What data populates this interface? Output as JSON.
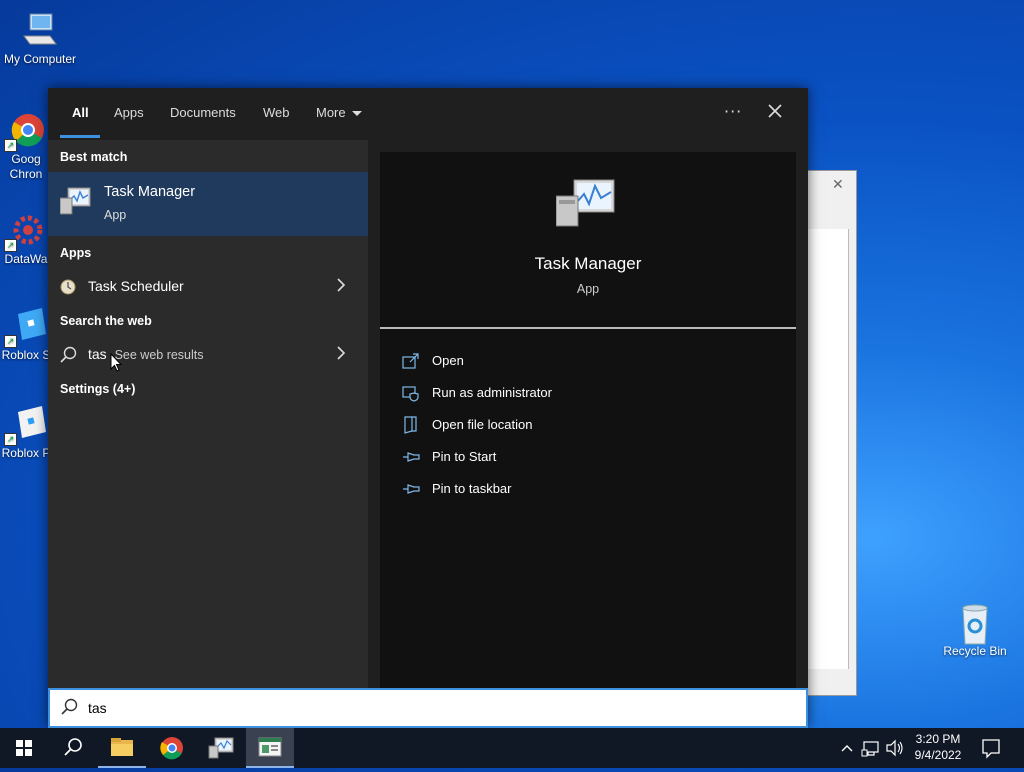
{
  "desktop": {
    "icons": [
      {
        "label": "My Computer"
      },
      {
        "label": "Goog\nChron"
      },
      {
        "label": "DataWa"
      },
      {
        "label": "Roblox S"
      },
      {
        "label": "Roblox P"
      },
      {
        "label": "Recycle Bin"
      }
    ]
  },
  "search": {
    "tabs": [
      {
        "label": "All",
        "active": true
      },
      {
        "label": "Apps"
      },
      {
        "label": "Documents"
      },
      {
        "label": "Web"
      },
      {
        "label": "More"
      }
    ],
    "more_options": "···",
    "sections": {
      "best_match": "Best match",
      "apps": "Apps",
      "web": "Search the web",
      "settings": "Settings (4+)"
    },
    "best_match": {
      "name": "Task Manager",
      "type": "App"
    },
    "apps": [
      {
        "name": "Task Scheduler"
      }
    ],
    "web": {
      "query": "tas",
      "suffix": "See web results"
    },
    "detail": {
      "name": "Task Manager",
      "type": "App",
      "actions": [
        {
          "label": "Open",
          "icon": "open-icon"
        },
        {
          "label": "Run as administrator",
          "icon": "shield-icon"
        },
        {
          "label": "Open file location",
          "icon": "file-location-icon"
        },
        {
          "label": "Pin to Start",
          "icon": "pin-icon"
        },
        {
          "label": "Pin to taskbar",
          "icon": "pin-icon"
        }
      ]
    },
    "query": "tas"
  },
  "taskbar": {
    "items": [
      "start-icon",
      "search-icon",
      "file-explorer-icon",
      "chrome-icon",
      "task-manager-icon",
      "app-icon"
    ],
    "clock": {
      "time": "3:20 PM",
      "date": "9/4/2022"
    }
  },
  "colors": {
    "accent": "#3d8fdf",
    "selected": "#1f3a5c",
    "taskbar": "#101826"
  }
}
